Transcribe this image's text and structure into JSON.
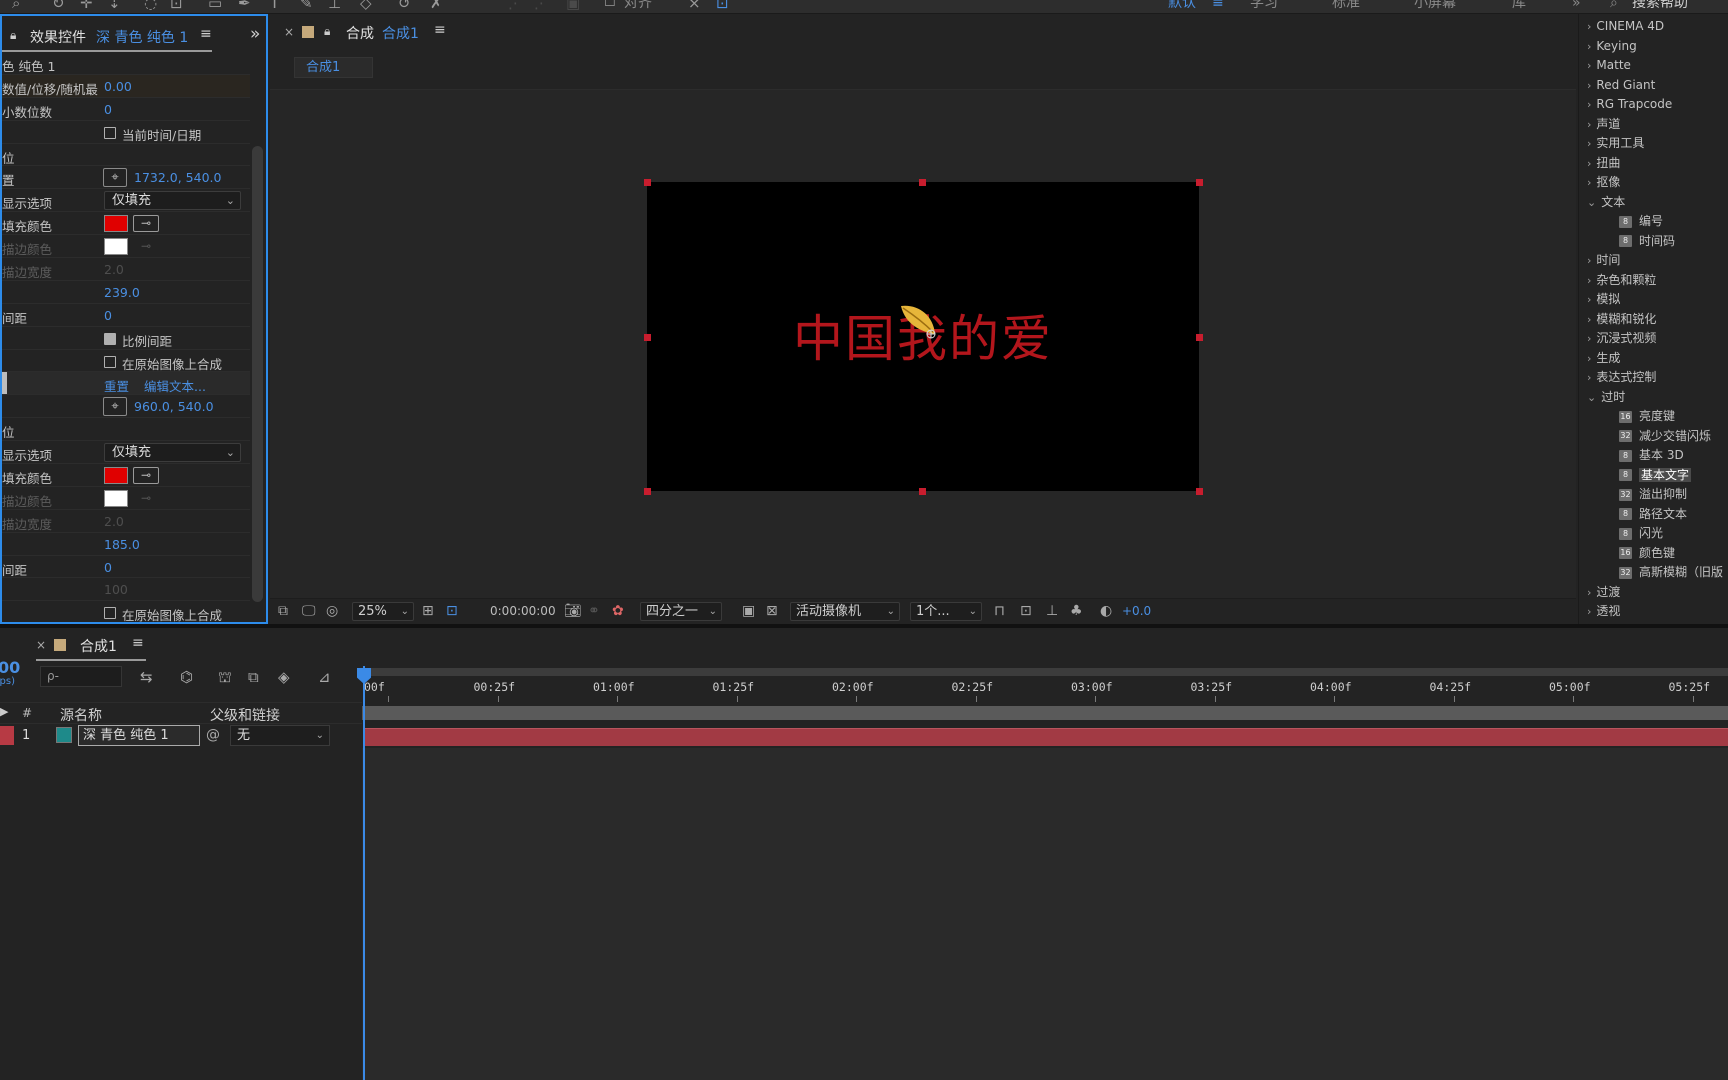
{
  "toolbar": {
    "workspaces": [
      "默认",
      "学习",
      "标准",
      "小屏幕",
      "库"
    ],
    "align_label": "对齐",
    "search_help": "搜索帮助"
  },
  "effect_controls": {
    "lock_icon": "lock-icon",
    "title": "效果控件",
    "layer_name": "深 青色 纯色 1",
    "menu_icon": "≡",
    "expand_icon": "»",
    "rows": {
      "r0": {
        "label": "色  纯色 1"
      },
      "r1": {
        "label": "数值/位移/随机最",
        "value": "0.00"
      },
      "r2": {
        "label": "小数位数",
        "value": "0"
      },
      "r3": {
        "label": "当前时间/日期"
      },
      "r4": {
        "label": "位"
      },
      "r5": {
        "label": "置",
        "value": "1732.0, 540.0"
      },
      "r6": {
        "label": "显示选项",
        "value": "仅填充"
      },
      "r7": {
        "label": "填充颜色"
      },
      "r8": {
        "label": "描边颜色"
      },
      "r9": {
        "label": "描边宽度",
        "value": "2.0"
      },
      "r10": {
        "value": "239.0"
      },
      "r11": {
        "label": "间距",
        "value": "0"
      },
      "r12": {
        "label": "比例间距"
      },
      "r13": {
        "label": "在原始图像上合成"
      },
      "r14": {
        "reset": "重置",
        "edit": "编辑文本..."
      },
      "r15": {
        "value": "960.0, 540.0"
      },
      "r16": {
        "label": "位"
      },
      "r17": {
        "label": "显示选项",
        "value": "仅填充"
      },
      "r18": {
        "label": "填充颜色"
      },
      "r19": {
        "label": "描边颜色"
      },
      "r20": {
        "label": "描边宽度",
        "value": "2.0"
      },
      "r21": {
        "value": "185.0"
      },
      "r22": {
        "label": "间距",
        "value": "0"
      },
      "r23": {
        "value": "100"
      },
      "r24": {
        "label": "在原始图像上合成"
      }
    },
    "colors": {
      "fill": "#e00000",
      "stroke": "#ffffff"
    }
  },
  "composition": {
    "close": "×",
    "lock_icon": "lock-icon",
    "title_prefix": "合成",
    "title_name": "合成1",
    "menu_icon": "≡",
    "breadcrumb": "合成1",
    "canvas_text": "中国我的爱",
    "text_color": "#b3161c",
    "bottom": {
      "zoom": "25%",
      "timecode": "0:00:00:00",
      "resolution": "四分之一",
      "camera": "活动摄像机",
      "views": "1个...",
      "exposure": "+0.0"
    }
  },
  "effects_presets": {
    "categories": [
      {
        "label": "CINEMA 4D",
        "expanded": false
      },
      {
        "label": "Keying",
        "expanded": false
      },
      {
        "label": "Matte",
        "expanded": false
      },
      {
        "label": "Red Giant",
        "expanded": false
      },
      {
        "label": "RG Trapcode",
        "expanded": false
      },
      {
        "label": "声道",
        "expanded": false
      },
      {
        "label": "实用工具",
        "expanded": false
      },
      {
        "label": "扭曲",
        "expanded": false
      },
      {
        "label": "抠像",
        "expanded": false
      },
      {
        "label": "文本",
        "expanded": true
      },
      {
        "label": "时间",
        "expanded": false
      },
      {
        "label": "杂色和颗粒",
        "expanded": false
      },
      {
        "label": "模拟",
        "expanded": false
      },
      {
        "label": "模糊和锐化",
        "expanded": false
      },
      {
        "label": "沉浸式视频",
        "expanded": false
      },
      {
        "label": "生成",
        "expanded": false
      },
      {
        "label": "表达式控制",
        "expanded": false
      },
      {
        "label": "过时",
        "expanded": true
      },
      {
        "label": "过渡",
        "expanded": false
      },
      {
        "label": "透视",
        "expanded": false
      }
    ],
    "text_items": [
      {
        "badge": "8",
        "label": "编号"
      },
      {
        "badge": "8",
        "label": "时间码"
      }
    ],
    "obsolete_items": [
      {
        "badge": "16",
        "label": "亮度键"
      },
      {
        "badge": "32",
        "label": "减少交错闪烁"
      },
      {
        "badge": "8",
        "label": "基本 3D"
      },
      {
        "badge": "8",
        "label": "基本文字",
        "selected": true
      },
      {
        "badge": "32",
        "label": "溢出抑制"
      },
      {
        "badge": "8",
        "label": "路径文本"
      },
      {
        "badge": "8",
        "label": "闪光"
      },
      {
        "badge": "16",
        "label": "颜色键"
      },
      {
        "badge": "32",
        "label": "高斯模糊（旧版"
      }
    ]
  },
  "timeline": {
    "close": "×",
    "comp_name": "合成1",
    "menu_icon": "≡",
    "current_time": "00",
    "fps_label": "fps)",
    "search_placeholder": "ρ-",
    "header": {
      "hash": "#",
      "source_name": "源名称",
      "parent_link": "父级和链接"
    },
    "layer": {
      "index": "1",
      "name": "深 青色 纯色 1",
      "parent": "无",
      "label_color": "#1e8a8a"
    },
    "ticks": [
      "00f",
      "00:25f",
      "01:00f",
      "01:25f",
      "02:00f",
      "02:25f",
      "03:00f",
      "03:25f",
      "04:00f",
      "04:25f",
      "05:00f",
      "05:25f"
    ]
  }
}
